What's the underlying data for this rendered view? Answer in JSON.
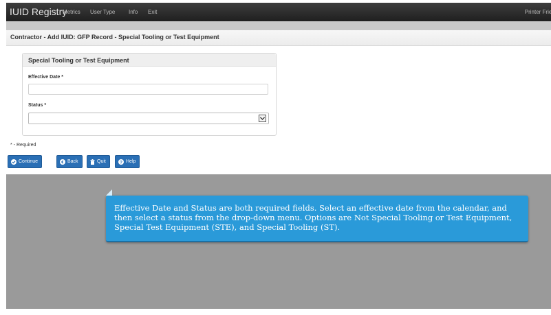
{
  "navbar": {
    "brand": "IUID Registry",
    "links": [
      "Metrics",
      "User Type",
      "Info",
      "Exit"
    ],
    "right_link": "Printer Friendly"
  },
  "page": {
    "title": "Contractor - Add IUID: GFP Record - Special Tooling or Test Equipment"
  },
  "panel": {
    "title": "Special Tooling or Test Equipment",
    "effective_date_label": "Effective Date *",
    "effective_date_value": "",
    "status_label": "Status *",
    "status_value": ""
  },
  "required_note": "* - Required",
  "buttons": {
    "continue": "Continue",
    "back": "Back",
    "quit": "Quit",
    "help": "Help"
  },
  "callout": {
    "text": "Effective Date and Status are both required fields. Select an effective date from the calendar, and then select a status from the drop-down menu. Options are Not Special Tooling or Test Equipment, Special Test Equipment (STE), and Special Tooling (ST)."
  },
  "colors": {
    "navbar": "#2b2b2b",
    "button": "#2a6fb5",
    "callout": "#2a9ad9",
    "backdrop": "#9a9a9a"
  },
  "icons": [
    "check-circle-icon",
    "back-circle-icon",
    "trash-icon",
    "question-circle-icon",
    "chevron-down-icon"
  ]
}
